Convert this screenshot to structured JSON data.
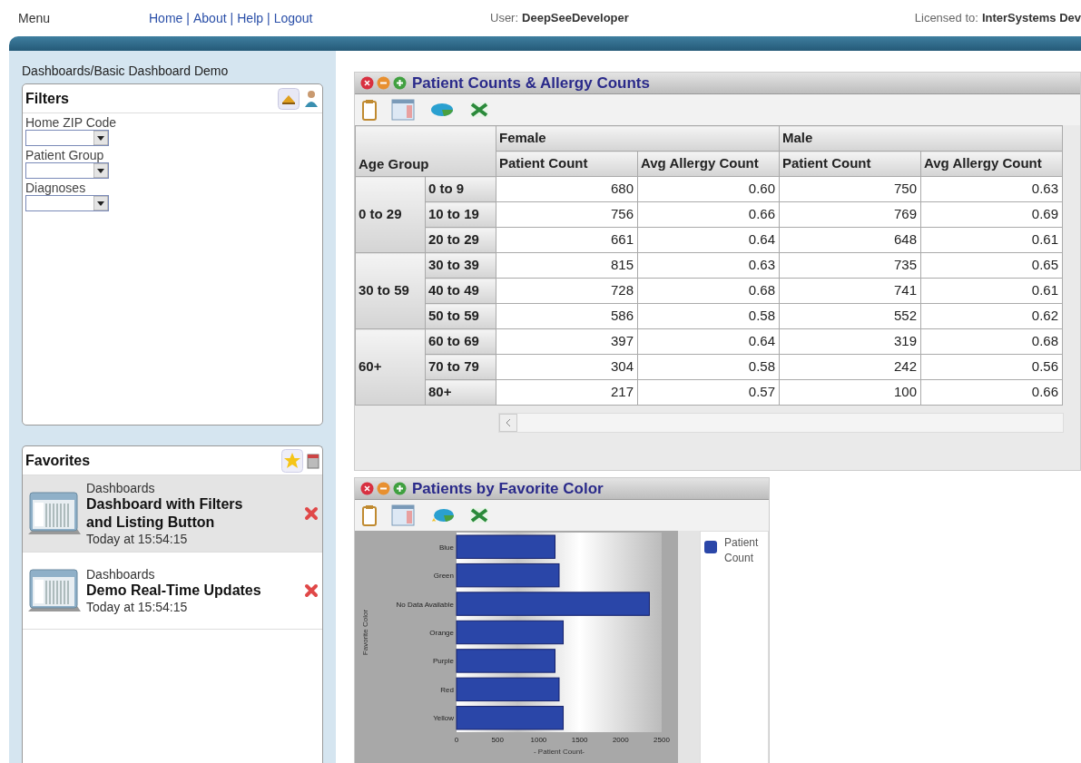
{
  "top_bar": {
    "menu": "Menu",
    "links": [
      "Home",
      "About",
      "Help",
      "Logout"
    ],
    "separator": "|",
    "user_label": "User:",
    "user": "DeepSeeDeveloper",
    "license_label": "Licensed to:",
    "license": "InterSystems Dev"
  },
  "breadcrumb": "Dashboards/Basic Dashboard Demo",
  "filters": {
    "title": "Filters",
    "items": [
      {
        "label": "Home ZIP Code"
      },
      {
        "label": "Patient Group"
      },
      {
        "label": "Diagnoses"
      }
    ]
  },
  "favorites": {
    "title": "Favorites",
    "items": [
      {
        "category": "Dashboards",
        "name": "Dashboard with Filters and Listing Button",
        "time": "Today at 15:54:15",
        "selected": true
      },
      {
        "category": "Dashboards",
        "name": "Demo Real-Time Updates",
        "time": "Today at 15:54:15",
        "selected": false
      }
    ]
  },
  "pivot": {
    "title": "Patient Counts & Allergy Counts",
    "row_header": "Age Group",
    "column_groups": [
      "Female",
      "Male"
    ],
    "measures": [
      "Patient Count",
      "Avg Allergy Count",
      "Patient Count",
      "Avg Allergy Count"
    ],
    "groups": [
      {
        "label": "0 to 29",
        "rows": [
          {
            "label": "0 to 9",
            "cells": [
              "680",
              "0.60",
              "750",
              "0.63"
            ]
          },
          {
            "label": "10 to 19",
            "cells": [
              "756",
              "0.66",
              "769",
              "0.69"
            ]
          },
          {
            "label": "20 to 29",
            "cells": [
              "661",
              "0.64",
              "648",
              "0.61"
            ]
          }
        ]
      },
      {
        "label": "30 to 59",
        "rows": [
          {
            "label": "30 to 39",
            "cells": [
              "815",
              "0.63",
              "735",
              "0.65"
            ]
          },
          {
            "label": "40 to 49",
            "cells": [
              "728",
              "0.68",
              "741",
              "0.61"
            ]
          },
          {
            "label": "50 to 59",
            "cells": [
              "586",
              "0.58",
              "552",
              "0.62"
            ]
          }
        ]
      },
      {
        "label": "60+",
        "rows": [
          {
            "label": "60 to 69",
            "cells": [
              "397",
              "0.64",
              "319",
              "0.68"
            ]
          },
          {
            "label": "70 to 79",
            "cells": [
              "304",
              "0.58",
              "242",
              "0.56"
            ]
          },
          {
            "label": "80+",
            "cells": [
              "217",
              "0.57",
              "100",
              "0.66"
            ]
          }
        ]
      }
    ]
  },
  "chart_panel": {
    "title": "Patients by Favorite Color",
    "chart_data": {
      "type": "bar",
      "orientation": "horizontal",
      "xlabel": "- Patient Count-",
      "ylabel": "Favorite Color",
      "categories": [
        "Blue",
        "Green",
        "No Data Available",
        "Orange",
        "Purple",
        "Red",
        "Yellow"
      ],
      "series": [
        {
          "name": "Patient Count",
          "color": "#2a46a8",
          "values": [
            1200,
            1250,
            2350,
            1300,
            1200,
            1250,
            1300
          ]
        }
      ],
      "xlim": [
        0,
        2500
      ],
      "xticks": [
        0,
        500,
        1000,
        1500,
        2000,
        2500
      ]
    }
  }
}
